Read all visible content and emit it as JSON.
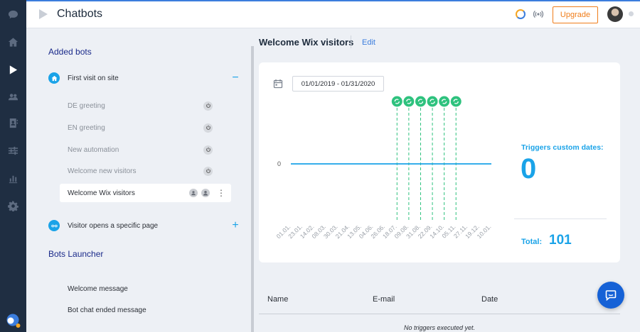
{
  "app": {
    "title": "Chatbots",
    "upgrade_label": "Upgrade"
  },
  "sidebar_rail": {
    "items": [
      {
        "icon": "chat-bubble-icon"
      },
      {
        "icon": "home-icon"
      },
      {
        "icon": "play-icon",
        "active": true
      },
      {
        "icon": "contacts-icon"
      },
      {
        "icon": "address-book-icon"
      },
      {
        "icon": "sliders-icon"
      },
      {
        "icon": "bar-chart-icon"
      },
      {
        "icon": "gear-icon"
      }
    ]
  },
  "left_panel": {
    "added_bots_title": "Added bots",
    "groups": [
      {
        "label": "First visit on site",
        "icon": "home-icon",
        "expanded": true,
        "toggle": "−",
        "bots": [
          {
            "label": "DE greeting"
          },
          {
            "label": "EN greeting"
          },
          {
            "label": "New automation"
          },
          {
            "label": "Welcome new visitors"
          },
          {
            "label": "Welcome Wix visitors",
            "selected": true
          }
        ]
      },
      {
        "label": "Visitor opens a specific page",
        "icon": "link-icon",
        "expanded": false,
        "toggle": "+"
      }
    ],
    "launcher_title": "Bots Launcher",
    "launcher_items": [
      {
        "label": "Welcome message"
      },
      {
        "label": "Bot chat ended message"
      }
    ]
  },
  "main": {
    "bot_name": "Welcome Wix visitors",
    "edit_label": "Edit",
    "date_range": "01/01/2019 - 01/31/2020",
    "stats": {
      "custom_label": "Triggers custom dates:",
      "custom_value": "0",
      "total_label": "Total:",
      "total_value": "101"
    },
    "table": {
      "columns": [
        "Name",
        "E-mail",
        "Date"
      ],
      "empty_message": "No triggers executed yet."
    }
  },
  "colors": {
    "accent": "#1aa3e8",
    "rail": "#1f2e42",
    "upgrade": "#f07d1a",
    "marker": "#2ec27e",
    "fab": "#1561d6"
  },
  "chart_data": {
    "type": "line",
    "x": [
      "01.01.",
      "23.01.",
      "14.02.",
      "08.03.",
      "30.03.",
      "21.04.",
      "13.05.",
      "04.06.",
      "26.06.",
      "18.07.",
      "09.08.",
      "31.08.",
      "22.09.",
      "14.10.",
      "05.11.",
      "27.11.",
      "19.12.",
      "10.01."
    ],
    "series": [
      {
        "values": [
          0,
          0,
          0,
          0,
          0,
          0,
          0,
          0,
          0,
          0,
          0,
          0,
          0,
          0,
          0,
          0,
          0,
          0
        ]
      }
    ],
    "yticks": [
      "0"
    ],
    "markers_at": [
      "18.07.",
      "09.08.",
      "31.08.",
      "22.09.",
      "14.10.",
      "05.11."
    ],
    "grid": false
  }
}
